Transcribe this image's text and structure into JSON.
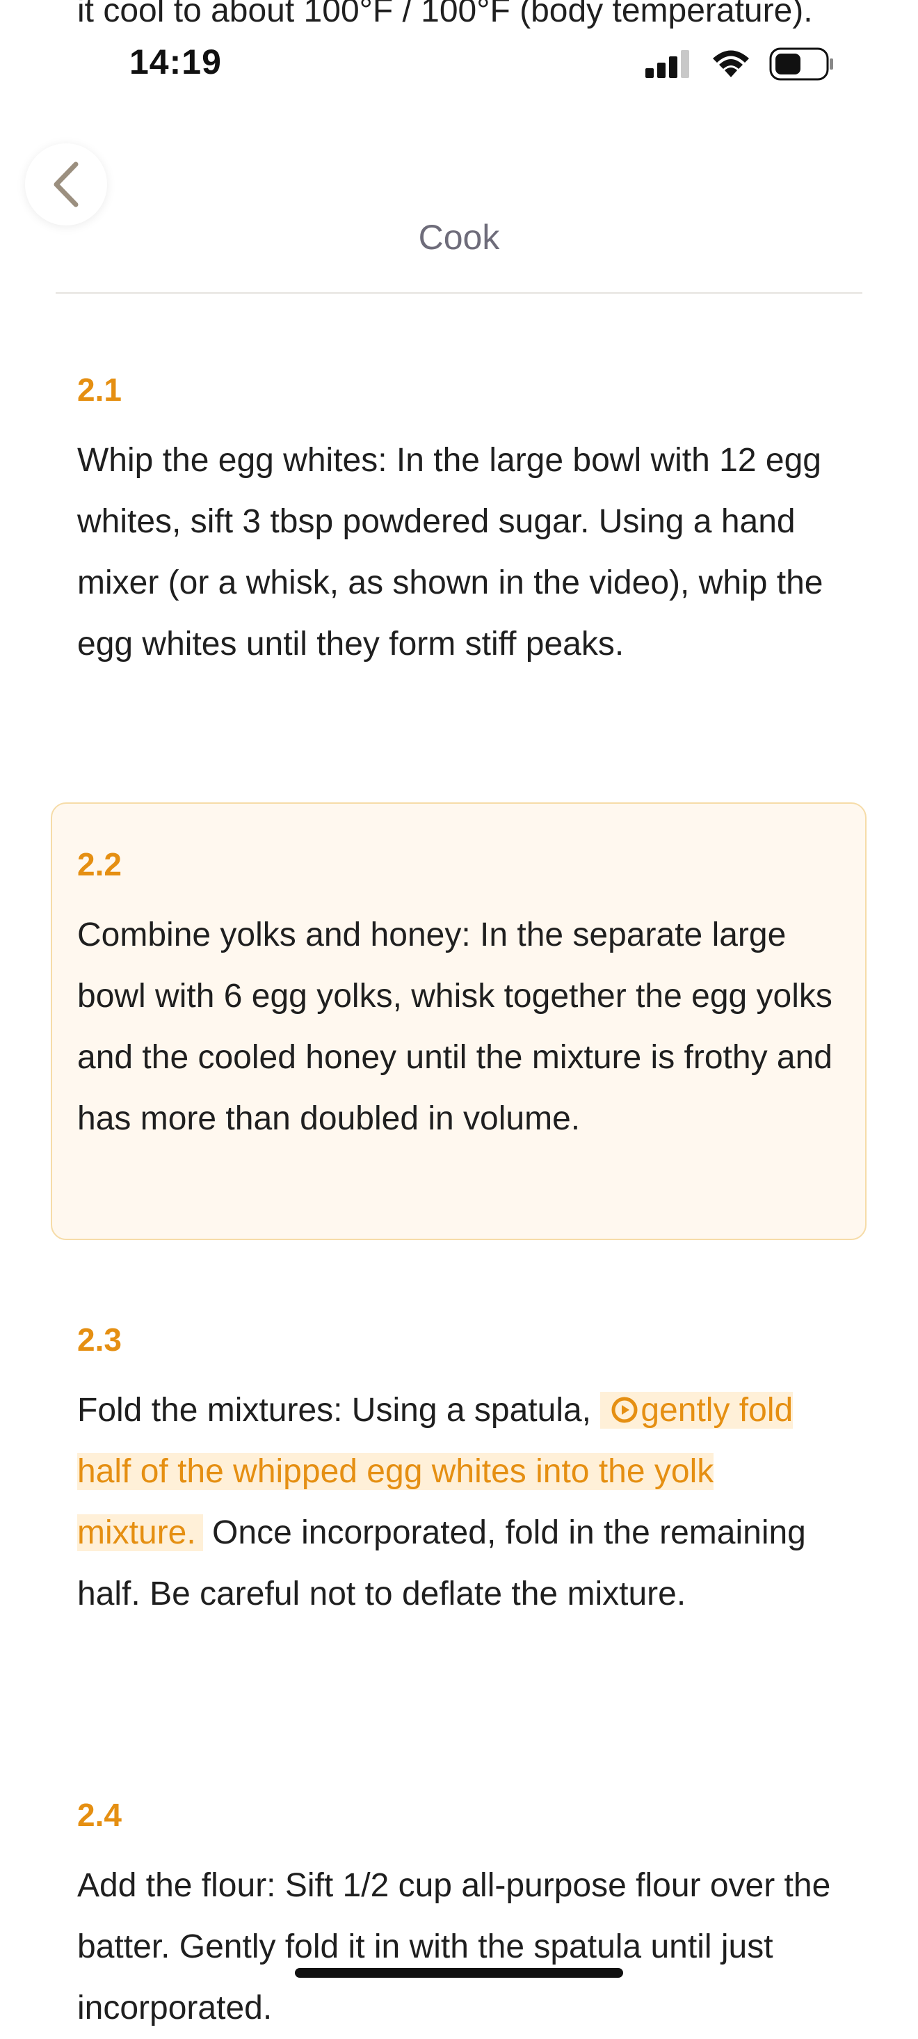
{
  "previous_text_fragment": "it cool to about 100°F / 100°F (body temperature).",
  "status_bar": {
    "time": "14:19"
  },
  "header": {
    "title": "Cook"
  },
  "icons": {
    "back": "chevron-left-icon",
    "signal": "cellular-signal-icon",
    "wifi": "wifi-icon",
    "battery": "battery-icon",
    "play": "play-circle-icon"
  },
  "colors": {
    "accent": "#e58f12",
    "highlight_card_bg": "#fff8ef",
    "highlight_card_border": "#f6dca8",
    "inline_highlight_bg": "#fff0d8",
    "title_gray": "#6e6c7a"
  },
  "steps": [
    {
      "number": "2.1",
      "text": "Whip the egg whites: In the large bowl with 12 egg whites, sift 3 tbsp powdered sugar. Using a hand mixer (or a whisk, as shown in the video), whip the egg whites until they form stiff peaks."
    },
    {
      "number": "2.2",
      "text": "Combine yolks and honey: In the separate large bowl with 6 egg yolks, whisk together the egg yolks and the cooled honey until the mixture is frothy and has more than doubled in volume.",
      "highlighted": true
    },
    {
      "number": "2.3",
      "text_before": "Fold the mixtures: Using a spatula,",
      "video_link": "gently fold half of the whipped egg whites into the yolk mixture.",
      "text_after": "Once incorporated, fold in the remaining half. Be careful not to deflate the mixture."
    },
    {
      "number": "2.4",
      "text": "Add the flour: Sift 1/2 cup all-purpose flour over the batter. Gently fold it in with the spatula until just incorporated."
    }
  ]
}
